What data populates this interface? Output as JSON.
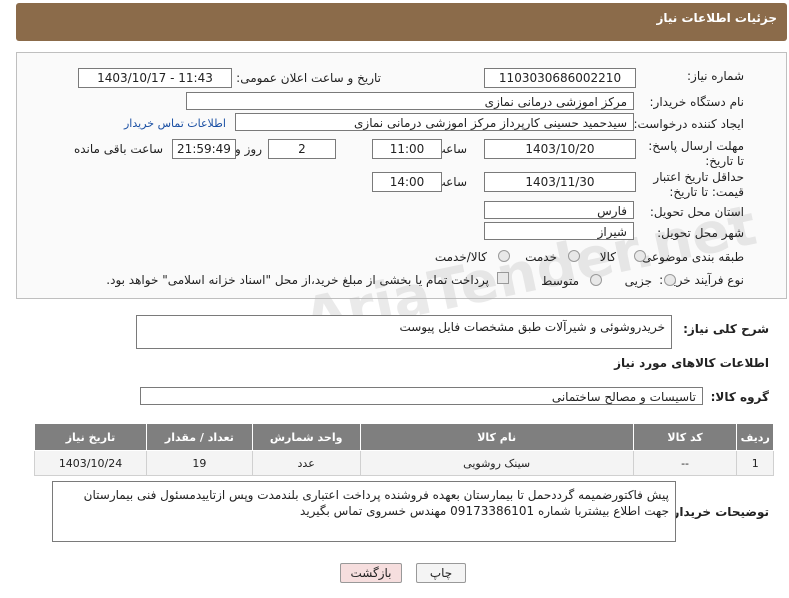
{
  "header": {
    "title": "جزئیات اطلاعات نیاز"
  },
  "fields": {
    "need_number_label": "شماره نیاز:",
    "need_number": "1103030686002210",
    "announce_label": "تاریخ و ساعت اعلان عمومی:",
    "announce_value": "1403/10/17 - 11:43",
    "buyer_org_label": "نام دستگاه خریدار:",
    "buyer_org": "مرکز اموزشی درمانی نمازی",
    "creator_label": "ایجاد کننده درخواست:",
    "creator": "سیدحمید حسینی کارپرداز مرکز اموزشی درمانی نمازی",
    "contact_link": "اطلاعات تماس خریدار",
    "deadline_label": "مهلت ارسال پاسخ: تا تاریخ:",
    "deadline_date": "1403/10/20",
    "time_label": "ساعت",
    "deadline_time": "11:00",
    "days_value": "2",
    "days_label": "روز و",
    "remaining_time": "21:59:49",
    "remaining_label": "ساعت باقی مانده",
    "validity_label": "حداقل تاریخ اعتبار قیمت: تا تاریخ:",
    "validity_date": "1403/11/30",
    "validity_time": "14:00",
    "province_label": "استان محل تحویل:",
    "province": "فارس",
    "city_label": "شهر محل تحویل:",
    "city": "شیراز",
    "category_label": "طبقه بندی موضوعی:",
    "cat_goods": "کالا",
    "cat_service": "خدمت",
    "cat_both": "کالا/خدمت",
    "process_label": "نوع فرآیند خرید :",
    "proc_partial": "جزیی",
    "proc_medium": "متوسط",
    "payment_note": "پرداخت تمام یا بخشی از مبلغ خرید،از محل \"اسناد خزانه اسلامی\" خواهد بود."
  },
  "summary": {
    "label": "شرح کلی نیاز:",
    "value": "خریدروشوئی و شیرآلات طبق مشخصات فایل پیوست"
  },
  "goods_info": {
    "title": "اطلاعات کالاهای مورد نیاز"
  },
  "goods_group": {
    "label": "گروه کالا:",
    "value": "تاسیسات و مصالح ساختمانی"
  },
  "table": {
    "headers": [
      "ردیف",
      "کد کالا",
      "نام کالا",
      "واحد شمارش",
      "تعداد / مقدار",
      "تاریخ نیاز"
    ],
    "rows": [
      [
        "1",
        "--",
        "سینک روشویی",
        "عدد",
        "19",
        "1403/10/24"
      ]
    ]
  },
  "buyer_notes": {
    "label": "توضیحات خریدار:",
    "value": "پیش فاکتورضمیمه گرددحمل تا بیمارستان بعهده فروشنده پرداخت اعتباری بلندمدت وپس ازتاییدمسئول فنی بیمارستان جهت اطلاع بیشتربا شماره 09173386101 مهندس خسروی تماس بگیرید"
  },
  "buttons": {
    "print": "چاپ",
    "back": "بازگشت"
  },
  "colors": {
    "header": "#8b6b4a",
    "table_header": "#7f7f7f",
    "back_button": "#f6dede"
  }
}
